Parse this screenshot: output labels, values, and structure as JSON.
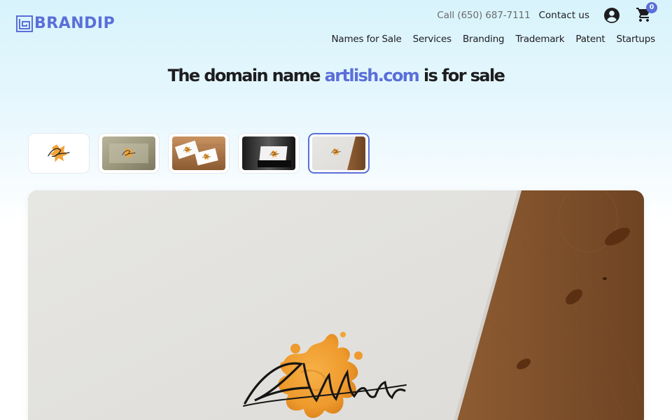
{
  "brand": {
    "name": "BRANDIP",
    "logo_icon": "brandip-logo-icon",
    "accent_color": "#5a6fd8"
  },
  "header": {
    "phone": "Call (650) 687-7111",
    "contact_label": "Contact us",
    "account_icon": "user-circle-icon",
    "cart_icon": "shopping-cart-icon",
    "cart_count": "0"
  },
  "nav": {
    "items": [
      {
        "label": "Names for Sale"
      },
      {
        "label": "Services"
      },
      {
        "label": "Branding"
      },
      {
        "label": "Trademark"
      },
      {
        "label": "Patent"
      },
      {
        "label": "Startups"
      }
    ]
  },
  "hero": {
    "title_prefix": "The domain name ",
    "domain": "artlish.com",
    "title_suffix": " is for sale"
  },
  "gallery": {
    "thumbnails": [
      {
        "label": "Logo on white"
      },
      {
        "label": "Logo on frosted glass"
      },
      {
        "label": "Business cards on wood"
      },
      {
        "label": "Card stand on dark"
      },
      {
        "label": "Paper on wooden desk"
      }
    ],
    "selected_index": 4,
    "preview_logo_text": "Artlish"
  }
}
